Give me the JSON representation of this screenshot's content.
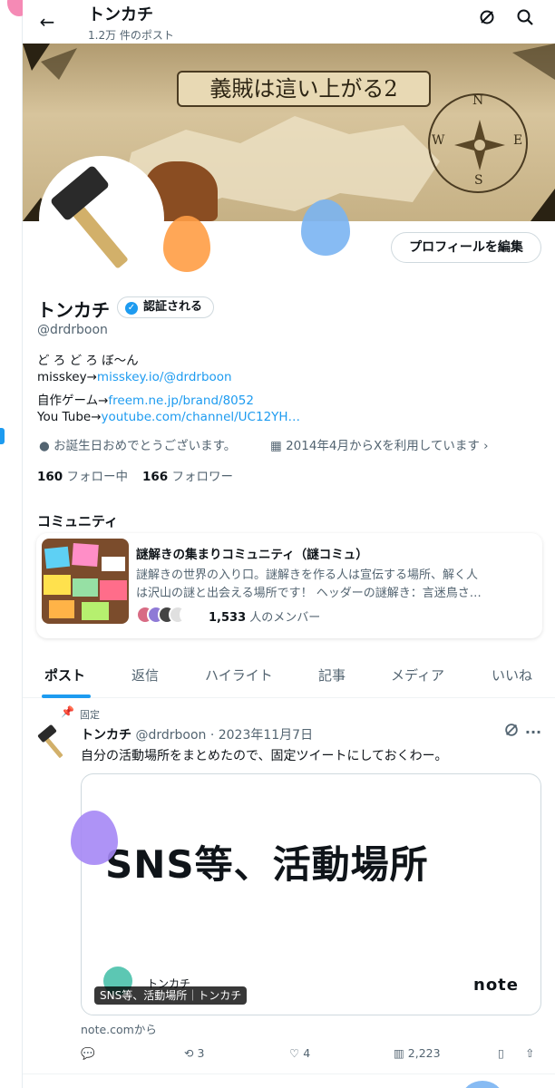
{
  "header": {
    "title": "トンカチ",
    "post_count": "1.2万 件のポスト"
  },
  "banner": {
    "map_title": "義賊は這い上がる2",
    "compass_n": "N",
    "compass_e": "E",
    "compass_w": "W",
    "compass_s": "S"
  },
  "profile": {
    "name": "トンカチ",
    "verified_label": "認証される",
    "handle": "@drdrboon",
    "edit_label": "プロフィールを編集",
    "bio_line1": "ど ろ ど ろ ぼ～ん",
    "bio_line2_prefix": "misskey→",
    "bio_line2_link": "misskey.io/@drdrboon",
    "bio_line3_prefix": "自作ゲーム→",
    "bio_line3_link": "freem.ne.jp/brand/8052",
    "bio_line4_prefix": "You Tube→",
    "bio_line4_link": "youtube.com/channel/UC12YH…",
    "birthday": "お誕生日おめでとうございます。",
    "joined": "2014年4月からXを利用しています",
    "following_count": "160",
    "following_label": "フォロー中",
    "followers_count": "166",
    "followers_label": "フォロワー"
  },
  "community": {
    "section_title": "コミュニティ",
    "name": "謎解きの集まりコミュニティ（謎コミュ）",
    "desc_line1": "謎解きの世界の入り口。謎解きを作る人は宣伝する場所、解く人",
    "desc_line2": "は沢山の謎と出会える場所です！ ヘッダーの謎解き：言迷鳥さ…",
    "member_count": "1,533",
    "member_label": "人のメンバー"
  },
  "tabs": [
    "ポスト",
    "返信",
    "ハイライト",
    "記事",
    "メディア",
    "いいね"
  ],
  "tweet": {
    "pinned_label": "固定",
    "author": "トンカチ",
    "handle_date": "@drdrboon · 2023年11月7日",
    "text": "自分の活動場所をまとめたので、固定ツイートにしておくわー。",
    "card_headline": "SNS等、活動場所",
    "card_author": "トンカチ",
    "card_brand": "note",
    "card_caption": "SNS等、活動場所｜トンカチ",
    "source": "note.comから",
    "retweets": "3",
    "likes": "4",
    "views": "2,223"
  },
  "colors": {
    "accent": "#1d9bf0",
    "text": "#0f1419",
    "muted": "#536471"
  }
}
